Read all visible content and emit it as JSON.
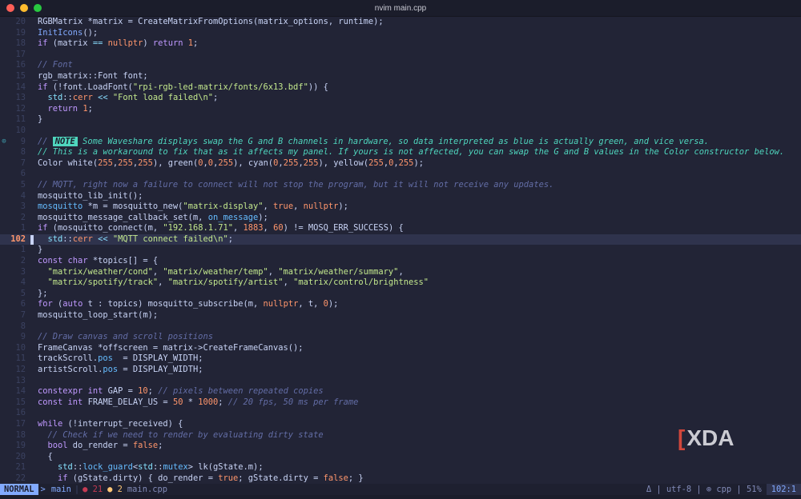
{
  "window": {
    "title": "nvim main.cpp"
  },
  "editor": {
    "lines": [
      {
        "num": "20",
        "segs": [
          [
            "",
            "RGBMatrix *matrix = CreateMatrixFromOptions(matrix_options, runtime);"
          ]
        ]
      },
      {
        "num": "19",
        "segs": [
          [
            "fn",
            "InitIcons"
          ],
          [
            "",
            "();"
          ]
        ]
      },
      {
        "num": "18",
        "segs": [
          [
            "kw",
            "if"
          ],
          [
            "",
            " (matrix "
          ],
          [
            "op",
            "=="
          ],
          [
            "",
            " "
          ],
          [
            "num",
            "nullptr"
          ],
          [
            "",
            ") "
          ],
          [
            "kw",
            "return"
          ],
          [
            "",
            " "
          ],
          [
            "num",
            "1"
          ],
          [
            "",
            ";"
          ]
        ]
      },
      {
        "num": "17",
        "segs": []
      },
      {
        "num": "16",
        "segs": [
          [
            "cm",
            "// Font"
          ]
        ]
      },
      {
        "num": "15",
        "segs": [
          [
            "",
            "rgb_matrix::Font font;"
          ]
        ]
      },
      {
        "num": "14",
        "segs": [
          [
            "kw",
            "if"
          ],
          [
            "",
            " (!font.LoadFont("
          ],
          [
            "str",
            "\"rpi-rgb-led-matrix/fonts/6x13.bdf\""
          ],
          [
            "",
            ")) {"
          ]
        ]
      },
      {
        "num": "13",
        "segs": [
          [
            "guide",
            "  "
          ],
          [
            "ns",
            "std"
          ],
          [
            "",
            "::"
          ],
          [
            "num",
            "cerr"
          ],
          [
            "",
            " "
          ],
          [
            "op",
            "<<"
          ],
          [
            "",
            " "
          ],
          [
            "str",
            "\"Font load failed\\n\""
          ],
          [
            "",
            ";"
          ]
        ]
      },
      {
        "num": "12",
        "segs": [
          [
            "guide",
            "  "
          ],
          [
            "kw",
            "return"
          ],
          [
            "",
            " "
          ],
          [
            "num",
            "1"
          ],
          [
            "",
            ";"
          ]
        ]
      },
      {
        "num": "11",
        "segs": [
          [
            "",
            "}"
          ]
        ]
      },
      {
        "num": "10",
        "segs": []
      },
      {
        "num": "9",
        "sign": "⊙",
        "segs": [
          [
            "cm",
            "// "
          ],
          [
            "note-badge",
            "NOTE"
          ],
          [
            "note-text",
            " Some Waveshare displays swap the G and B channels in hardware, so data interpreted as blue is actually green, and vice versa."
          ]
        ]
      },
      {
        "num": "8",
        "segs": [
          [
            "note-text",
            "// This is a workaround to fix that as it affects my panel. If yours is not affected, you can swap the G and B values in the Color constructor below."
          ]
        ]
      },
      {
        "num": "7",
        "segs": [
          [
            "",
            "Color white("
          ],
          [
            "num",
            "255"
          ],
          [
            "",
            ","
          ],
          [
            "num",
            "255"
          ],
          [
            "",
            ","
          ],
          [
            "num",
            "255"
          ],
          [
            "",
            "), green("
          ],
          [
            "num",
            "0"
          ],
          [
            "",
            ","
          ],
          [
            "num",
            "0"
          ],
          [
            "",
            ","
          ],
          [
            "num",
            "255"
          ],
          [
            "",
            "), cyan("
          ],
          [
            "num",
            "0"
          ],
          [
            "",
            ","
          ],
          [
            "num",
            "255"
          ],
          [
            "",
            ","
          ],
          [
            "num",
            "255"
          ],
          [
            "",
            "), yellow("
          ],
          [
            "num",
            "255"
          ],
          [
            "",
            ","
          ],
          [
            "num",
            "0"
          ],
          [
            "",
            ","
          ],
          [
            "num",
            "255"
          ],
          [
            "",
            ");"
          ]
        ]
      },
      {
        "num": "6",
        "segs": []
      },
      {
        "num": "5",
        "segs": [
          [
            "cm",
            "// MQTT, right now a failure to connect will not stop the program, but it will not receive any updates."
          ]
        ]
      },
      {
        "num": "4",
        "segs": [
          [
            "",
            "mosquitto_lib_init();"
          ]
        ]
      },
      {
        "num": "3",
        "segs": [
          [
            "ty",
            "mosquitto"
          ],
          [
            "",
            " *m = mosquitto_new("
          ],
          [
            "str",
            "\"matrix-display\""
          ],
          [
            "",
            ", "
          ],
          [
            "num",
            "true"
          ],
          [
            "",
            ", "
          ],
          [
            "num",
            "nullptr"
          ],
          [
            "",
            ");"
          ]
        ]
      },
      {
        "num": "2",
        "segs": [
          [
            "",
            "mosquitto_message_callback_set(m, "
          ],
          [
            "ty",
            "on_message"
          ],
          [
            "",
            ");"
          ]
        ]
      },
      {
        "num": "1",
        "segs": [
          [
            "kw",
            "if"
          ],
          [
            "",
            " (mosquitto_connect(m, "
          ],
          [
            "str",
            "\"192.168.1.71\""
          ],
          [
            "",
            ", "
          ],
          [
            "num",
            "1883"
          ],
          [
            "",
            ", "
          ],
          [
            "num",
            "60"
          ],
          [
            "",
            ") != MOSQ_ERR_SUCCESS) {"
          ]
        ]
      },
      {
        "num": "102",
        "current": true,
        "segs": [
          [
            "guide",
            "  "
          ],
          [
            "ns",
            "std"
          ],
          [
            "",
            "::"
          ],
          [
            "num",
            "cerr"
          ],
          [
            "",
            " "
          ],
          [
            "op",
            "<<"
          ],
          [
            "",
            " "
          ],
          [
            "str",
            "\"MQTT connect failed\\n\""
          ],
          [
            "",
            ";"
          ]
        ]
      },
      {
        "num": "1",
        "segs": [
          [
            "",
            "}"
          ]
        ]
      },
      {
        "num": "2",
        "segs": [
          [
            "kw",
            "const"
          ],
          [
            "",
            " "
          ],
          [
            "kw",
            "char"
          ],
          [
            "",
            " *topics[] = {"
          ]
        ]
      },
      {
        "num": "3",
        "segs": [
          [
            "guide",
            "  "
          ],
          [
            "str",
            "\"matrix/weather/cond\""
          ],
          [
            "",
            ", "
          ],
          [
            "str",
            "\"matrix/weather/temp\""
          ],
          [
            "",
            ", "
          ],
          [
            "str",
            "\"matrix/weather/summary\""
          ],
          [
            "",
            ","
          ]
        ]
      },
      {
        "num": "4",
        "segs": [
          [
            "guide",
            "  "
          ],
          [
            "str",
            "\"matrix/spotify/track\""
          ],
          [
            "",
            ", "
          ],
          [
            "str",
            "\"matrix/spotify/artist\""
          ],
          [
            "",
            ", "
          ],
          [
            "str",
            "\"matrix/control/brightness\""
          ]
        ]
      },
      {
        "num": "5",
        "segs": [
          [
            "",
            "};"
          ]
        ]
      },
      {
        "num": "6",
        "segs": [
          [
            "kw",
            "for"
          ],
          [
            "",
            " ("
          ],
          [
            "kw",
            "auto"
          ],
          [
            "",
            " t : topics) mosquitto_subscribe(m, "
          ],
          [
            "num",
            "nullptr"
          ],
          [
            "",
            ", t, "
          ],
          [
            "num",
            "0"
          ],
          [
            "",
            ");"
          ]
        ]
      },
      {
        "num": "7",
        "segs": [
          [
            "",
            "mosquitto_loop_start(m);"
          ]
        ]
      },
      {
        "num": "8",
        "segs": []
      },
      {
        "num": "9",
        "segs": [
          [
            "cm",
            "// Draw canvas and scroll positions"
          ]
        ]
      },
      {
        "num": "10",
        "segs": [
          [
            "",
            "FrameCanvas *offscreen = matrix->CreateFrameCanvas();"
          ]
        ]
      },
      {
        "num": "11",
        "segs": [
          [
            "",
            "trackScroll."
          ],
          [
            "ty",
            "pos"
          ],
          [
            "",
            "  = DISPLAY_WIDTH;"
          ]
        ]
      },
      {
        "num": "12",
        "segs": [
          [
            "",
            "artistScroll."
          ],
          [
            "ty",
            "pos"
          ],
          [
            "",
            " = DISPLAY_WIDTH;"
          ]
        ]
      },
      {
        "num": "13",
        "segs": []
      },
      {
        "num": "14",
        "segs": [
          [
            "kw",
            "constexpr"
          ],
          [
            "",
            " "
          ],
          [
            "kw",
            "int"
          ],
          [
            "",
            " GAP = "
          ],
          [
            "num",
            "10"
          ],
          [
            "",
            "; "
          ],
          [
            "cm",
            "// pixels between repeated copies"
          ]
        ]
      },
      {
        "num": "15",
        "segs": [
          [
            "kw",
            "const"
          ],
          [
            "",
            " "
          ],
          [
            "kw",
            "int"
          ],
          [
            "",
            " FRAME_DELAY_US = "
          ],
          [
            "num",
            "50"
          ],
          [
            "",
            " * "
          ],
          [
            "num",
            "1000"
          ],
          [
            "",
            "; "
          ],
          [
            "cm",
            "// 20 fps, 50 ms per frame"
          ]
        ]
      },
      {
        "num": "16",
        "segs": []
      },
      {
        "num": "17",
        "segs": [
          [
            "kw",
            "while"
          ],
          [
            "",
            " (!interrupt_received) {"
          ]
        ]
      },
      {
        "num": "18",
        "segs": [
          [
            "guide",
            "  "
          ],
          [
            "cm",
            "// Check if we need to render by evaluating dirty state"
          ]
        ]
      },
      {
        "num": "19",
        "segs": [
          [
            "guide",
            "  "
          ],
          [
            "kw",
            "bool"
          ],
          [
            "",
            " do_render = "
          ],
          [
            "num",
            "false"
          ],
          [
            "",
            ";"
          ]
        ]
      },
      {
        "num": "20",
        "segs": [
          [
            "guide",
            "  "
          ],
          [
            "",
            "{"
          ]
        ]
      },
      {
        "num": "21",
        "segs": [
          [
            "guide",
            "    "
          ],
          [
            "ns",
            "std"
          ],
          [
            "",
            "::"
          ],
          [
            "ty",
            "lock_guard"
          ],
          [
            "",
            "<"
          ],
          [
            "ns",
            "std"
          ],
          [
            "",
            "::"
          ],
          [
            "ty",
            "mutex"
          ],
          [
            "",
            "> lk(gState.m);"
          ]
        ]
      },
      {
        "num": "22",
        "segs": [
          [
            "guide",
            "    "
          ],
          [
            "kw",
            "if"
          ],
          [
            "",
            " (gState.dirty) { do_render = "
          ],
          [
            "num",
            "true"
          ],
          [
            "",
            "; gState.dirty = "
          ],
          [
            "num",
            "false"
          ],
          [
            "",
            "; }"
          ]
        ]
      }
    ]
  },
  "statusbar": {
    "mode": "NORMAL",
    "branch": " main",
    "errors": "● 21",
    "warnings": "● 2",
    "filename": "main.cpp",
    "right": "Δ | utf-8 | ⊚ cpp | 51%",
    "position": "102:1"
  },
  "watermark": {
    "text": "XDA"
  }
}
